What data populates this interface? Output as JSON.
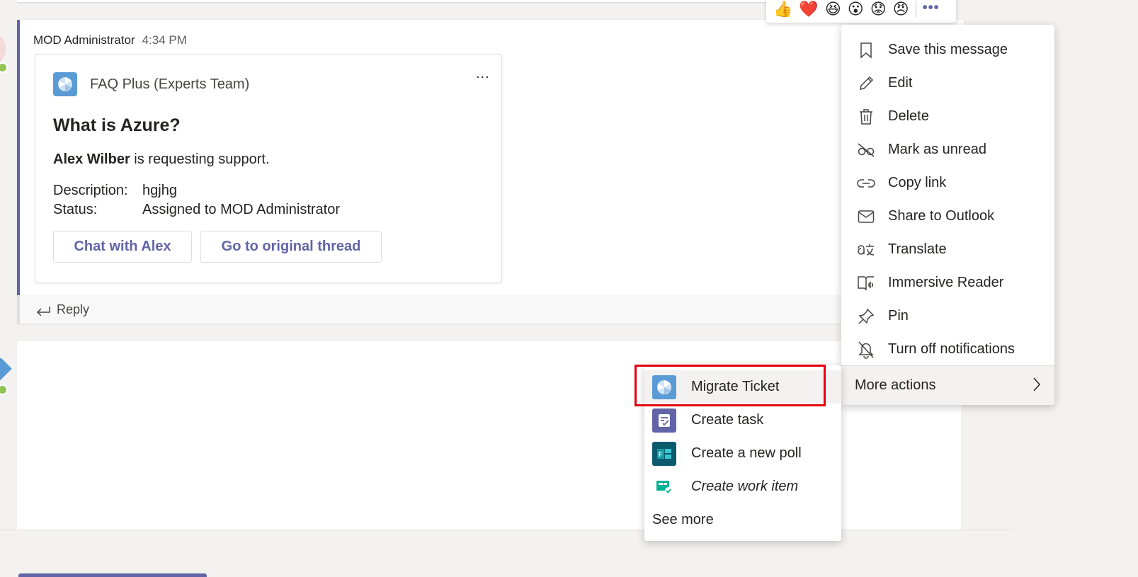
{
  "message": {
    "sender": "MOD Administrator",
    "time": "4:34 PM",
    "card": {
      "app_name": "FAQ Plus (Experts Team)",
      "more": "...",
      "title": "What is Azure?",
      "requester": "Alex Wilber",
      "requesting_text": " is requesting support.",
      "facts": [
        {
          "label": "Description:",
          "value": "hgjhg"
        },
        {
          "label": "Status:",
          "value": "Assigned to MOD Administrator"
        }
      ],
      "buttons": {
        "chat": "Chat with Alex",
        "thread": "Go to original thread"
      }
    },
    "reply_label": "Reply"
  },
  "reactions": {
    "emojis": [
      "👍",
      "❤️",
      "😆",
      "😮",
      "😟",
      "😠"
    ],
    "more": "•••"
  },
  "context_menu": {
    "items": [
      {
        "label": "Save this message",
        "icon": "bookmark-icon"
      },
      {
        "label": "Edit",
        "icon": "pencil-icon"
      },
      {
        "label": "Delete",
        "icon": "trash-icon"
      },
      {
        "label": "Mark as unread",
        "icon": "eye-off-icon"
      },
      {
        "label": "Copy link",
        "icon": "link-icon"
      },
      {
        "label": "Share to Outlook",
        "icon": "mail-icon"
      },
      {
        "label": "Translate",
        "icon": "translate-icon"
      },
      {
        "label": "Immersive Reader",
        "icon": "reader-icon"
      },
      {
        "label": "Pin",
        "icon": "pin-icon"
      },
      {
        "label": "Turn off notifications",
        "icon": "bell-off-icon"
      }
    ],
    "more_actions": "More actions"
  },
  "submenu": {
    "items": [
      {
        "label": "Migrate Ticket",
        "icon": "faq-plus-icon",
        "color": "#5b9bd5"
      },
      {
        "label": "Create task",
        "icon": "tasks-icon",
        "color": "#6264a7"
      },
      {
        "label": "Create a new poll",
        "icon": "forms-icon",
        "color": "#0b5a6e"
      },
      {
        "label": "Create work item",
        "icon": "boards-icon",
        "color": "#00b294"
      }
    ],
    "see_more": "See more"
  },
  "colors": {
    "accent": "#6264a7",
    "highlight": "#e3000f",
    "presence": "#92c353"
  }
}
